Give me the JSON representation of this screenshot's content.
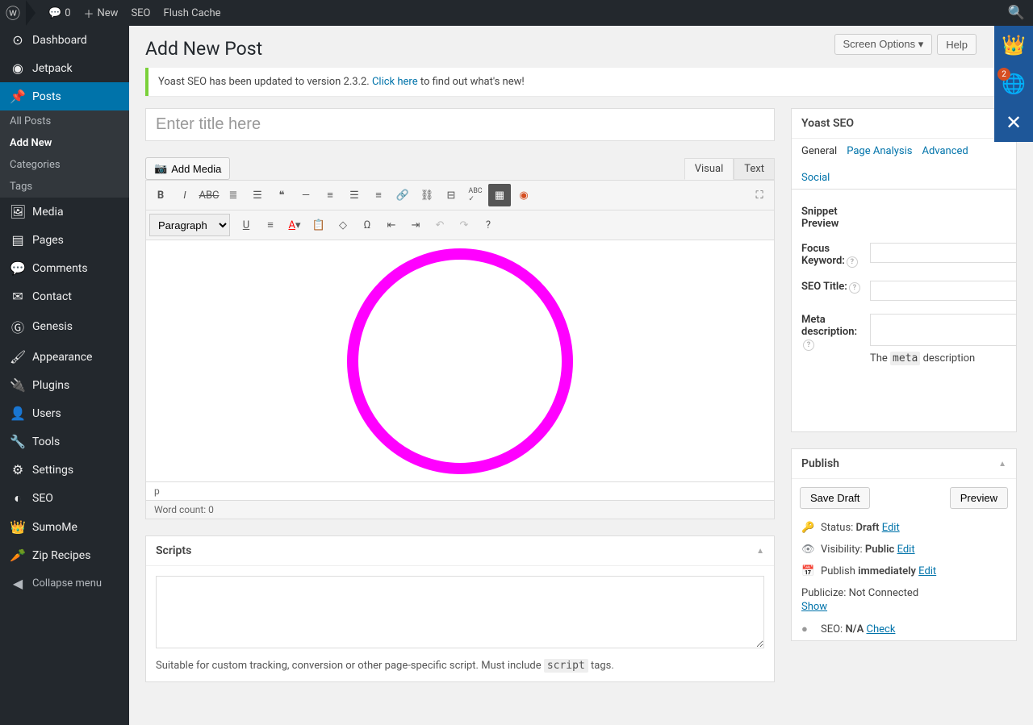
{
  "topbar": {
    "comments": "0",
    "new": "New",
    "seo": "SEO",
    "flush": "Flush Cache"
  },
  "topright": {
    "screen_options": "Screen Options",
    "help": "Help"
  },
  "sidebar": {
    "dashboard": "Dashboard",
    "jetpack": "Jetpack",
    "posts": "Posts",
    "posts_sub": {
      "all": "All Posts",
      "add": "Add New",
      "cat": "Categories",
      "tags": "Tags"
    },
    "media": "Media",
    "pages": "Pages",
    "comments": "Comments",
    "contact": "Contact",
    "genesis": "Genesis",
    "appearance": "Appearance",
    "plugins": "Plugins",
    "users": "Users",
    "tools": "Tools",
    "settings": "Settings",
    "seo": "SEO",
    "sumome": "SumoMe",
    "zip": "Zip Recipes",
    "collapse": "Collapse menu"
  },
  "page": {
    "title": "Add New Post"
  },
  "notice": {
    "pre": "Yoast SEO has been updated to version 2.3.2. ",
    "link": "Click here",
    "post": " to find out what's new!"
  },
  "editor": {
    "title_placeholder": "Enter title here",
    "add_media": "Add Media",
    "tab_visual": "Visual",
    "tab_text": "Text",
    "paragraph": "Paragraph",
    "path": "p",
    "word_count": "Word count: 0"
  },
  "scripts": {
    "title": "Scripts",
    "note_pre": "Suitable for custom tracking, conversion or other page-specific script. Must include ",
    "note_code": "script",
    "note_post": " tags."
  },
  "yoast": {
    "title": "Yoast SEO",
    "tabs": {
      "general": "General",
      "page_analysis": "Page Analysis",
      "advanced": "Advanced",
      "social": "Social"
    },
    "snippet": "Snippet Preview",
    "focus_kw": "Focus Keyword:",
    "seo_title": "SEO Title:",
    "meta_desc": "Meta description:",
    "meta_note_pre": "The ",
    "meta_note_code": "meta",
    "meta_note_post": " description"
  },
  "publish": {
    "title": "Publish",
    "save_draft": "Save Draft",
    "preview": "Preview",
    "status_label": "Status: ",
    "status_value": "Draft",
    "visibility_label": "Visibility: ",
    "visibility_value": "Public",
    "schedule_label": "Publish ",
    "schedule_value": "immediately",
    "edit": "Edit",
    "publicize_label": "Publicize: Not Connected",
    "show": "Show",
    "seo_label": "SEO: ",
    "seo_value": "N/A",
    "check": "Check"
  },
  "sumome": {
    "badge": "2"
  }
}
